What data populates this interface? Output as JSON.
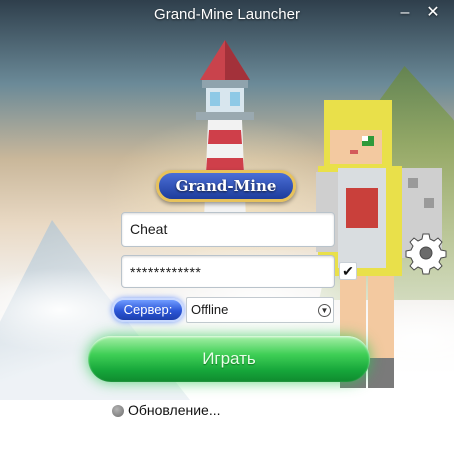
{
  "window": {
    "title": "Grand-Mine Launcher",
    "minimize_icon": "minimize-icon",
    "close_icon": "close-icon",
    "minimize_glyph": "–",
    "close_glyph": "✕"
  },
  "branding": {
    "logo_text": "Grand-Mine"
  },
  "login": {
    "username": "Cheat",
    "password_masked": "************",
    "remember_checked": true,
    "check_glyph": "✔"
  },
  "server": {
    "label": "Сервер:",
    "selected": "Offline",
    "arrow_glyph": "▼"
  },
  "play_button": {
    "label": "Играть"
  },
  "status": {
    "text": "Обновление..."
  },
  "icons": {
    "settings": "gear-icon"
  },
  "colors": {
    "play_green": "#2fbf4a",
    "server_blue": "#2b55d6",
    "logo_gold": "#e7c25b"
  }
}
